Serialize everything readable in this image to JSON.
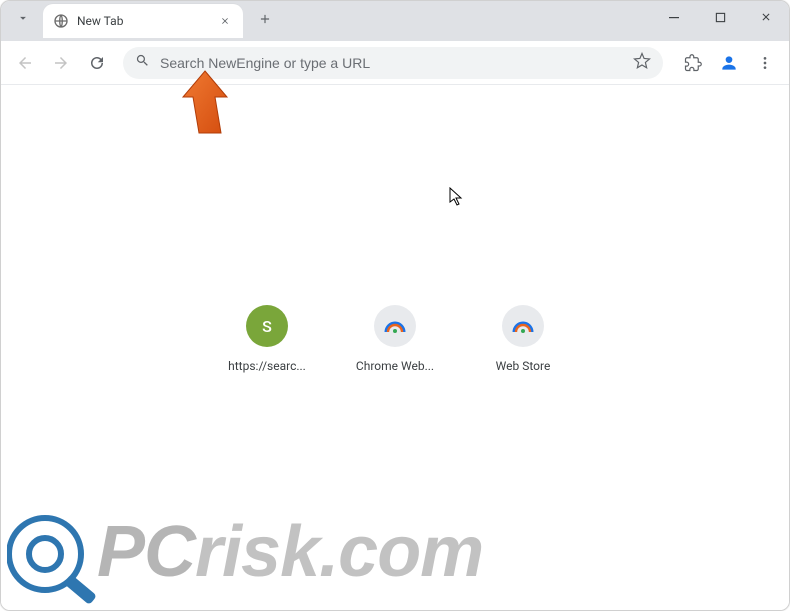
{
  "tab": {
    "title": "New Tab"
  },
  "omnibox": {
    "placeholder": "Search NewEngine or type a URL",
    "value": ""
  },
  "shortcuts": [
    {
      "label": "https://searc...",
      "letter": "S",
      "kind": "letter-green"
    },
    {
      "label": "Chrome Web...",
      "kind": "rainbow"
    },
    {
      "label": "Web Store",
      "kind": "rainbow"
    }
  ],
  "watermark": {
    "text_pc": "PC",
    "text_risk": "risk.com"
  },
  "colors": {
    "accent_blue": "#1a73e8",
    "arrow_orange": "#e8641e",
    "shortcut_green": "#7aa63a",
    "titlebar_bg": "#dfe1e5",
    "omnibox_bg": "#f1f3f4"
  }
}
